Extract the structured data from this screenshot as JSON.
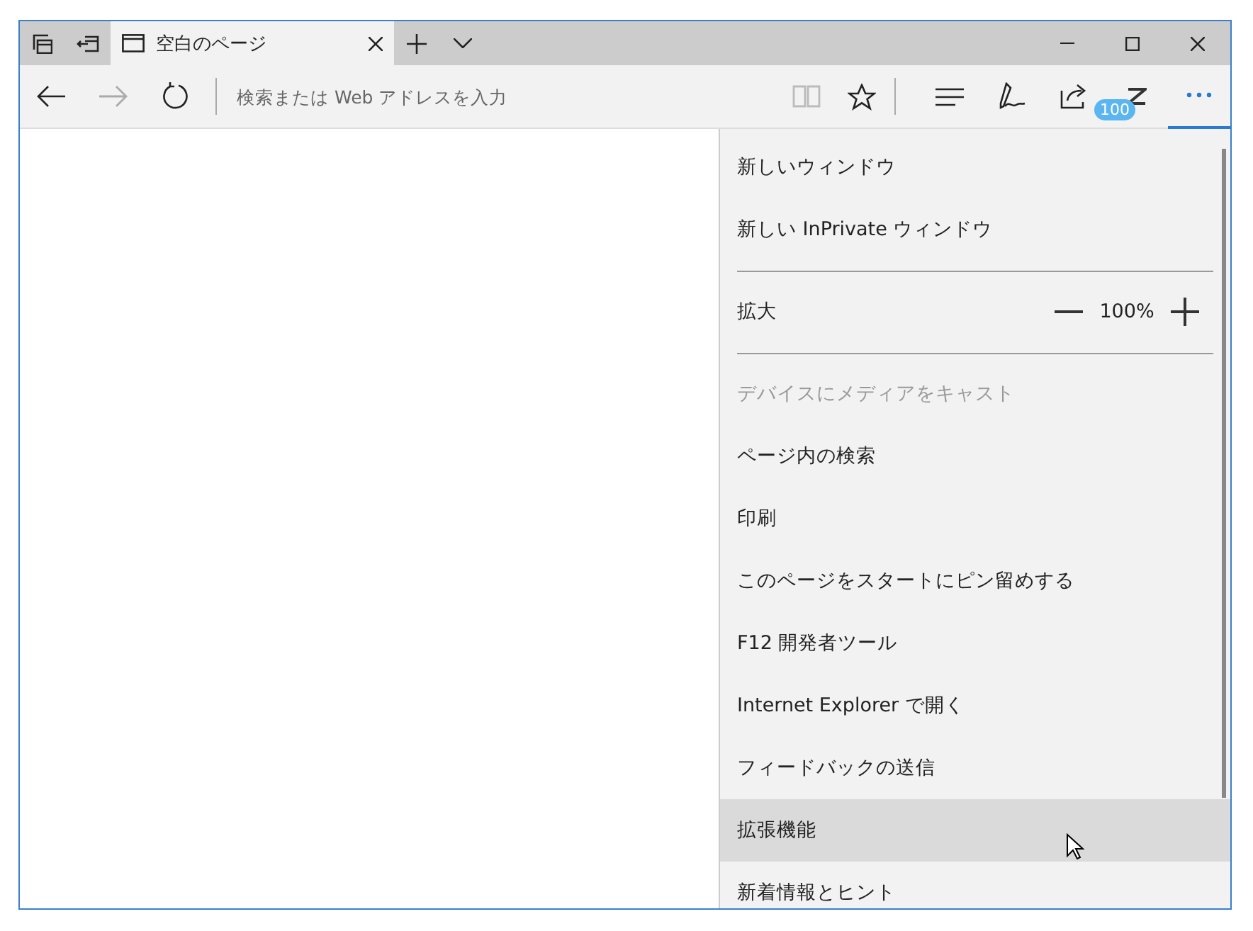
{
  "tab": {
    "title": "空白のページ",
    "selected": true
  },
  "address_bar": {
    "placeholder": "検索または Web アドレスを入力"
  },
  "extension_badge": "100",
  "menu": {
    "items": [
      {
        "kind": "item",
        "label": "新しいウィンドウ",
        "disabled": false,
        "hovered": false
      },
      {
        "kind": "item",
        "label": "新しい InPrivate ウィンドウ",
        "disabled": false,
        "hovered": false
      },
      {
        "kind": "separator"
      },
      {
        "kind": "zoom",
        "label": "拡大",
        "value": "100%"
      },
      {
        "kind": "separator"
      },
      {
        "kind": "item",
        "label": "デバイスにメディアをキャスト",
        "disabled": true,
        "hovered": false
      },
      {
        "kind": "item",
        "label": "ページ内の検索",
        "disabled": false,
        "hovered": false
      },
      {
        "kind": "item",
        "label": "印刷",
        "disabled": false,
        "hovered": false
      },
      {
        "kind": "item",
        "label": "このページをスタートにピン留めする",
        "disabled": false,
        "hovered": false
      },
      {
        "kind": "item",
        "label": "F12 開発者ツール",
        "disabled": false,
        "hovered": false
      },
      {
        "kind": "item",
        "label": "Internet Explorer で開く",
        "disabled": false,
        "hovered": false
      },
      {
        "kind": "item",
        "label": "フィードバックの送信",
        "disabled": false,
        "hovered": false
      },
      {
        "kind": "item",
        "label": "拡張機能",
        "disabled": false,
        "hovered": true
      },
      {
        "kind": "item",
        "label": "新着情報とヒント",
        "disabled": false,
        "hovered": false
      }
    ]
  }
}
